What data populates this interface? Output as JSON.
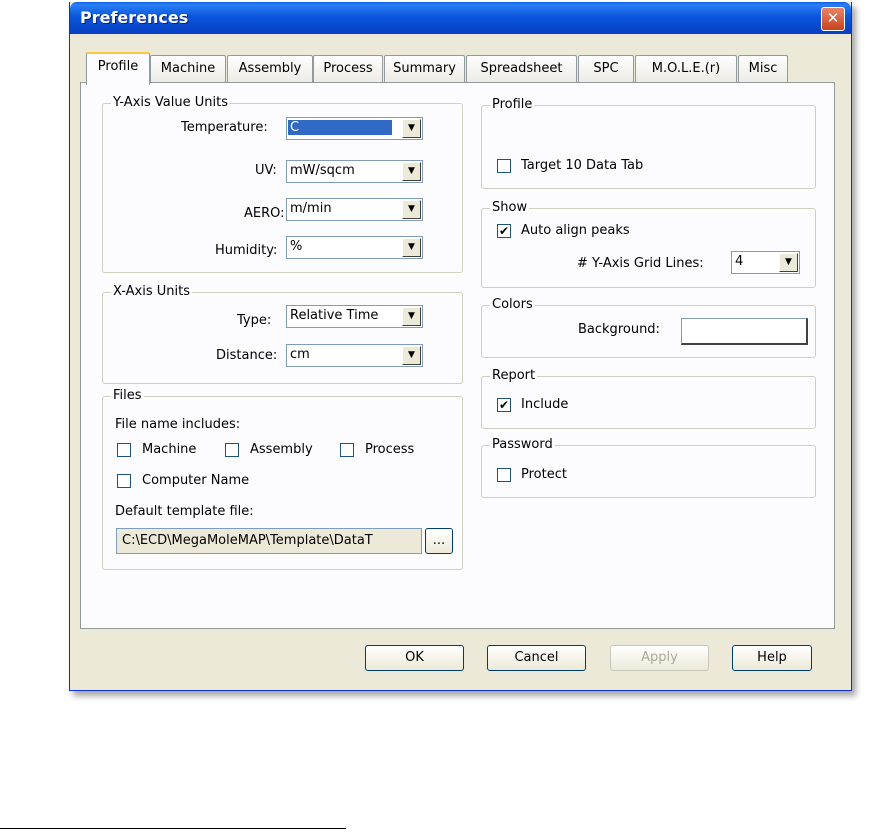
{
  "window": {
    "title": "Preferences",
    "close_glyph": "✕"
  },
  "tabs": [
    "Profile",
    "Machine",
    "Assembly",
    "Process",
    "Summary",
    "Spreadsheet",
    "SPC",
    "M.O.L.E.(r)",
    "Misc"
  ],
  "y_axis": {
    "legend": "Y-Axis Value Units",
    "temperature_label": "Temperature:",
    "temperature_value": "C",
    "uv_label": "UV:",
    "uv_value": "mW/sqcm",
    "aero_label": "AERO:",
    "aero_value": "m/min",
    "humidity_label": "Humidity:",
    "humidity_value": "%"
  },
  "x_axis": {
    "legend": "X-Axis Units",
    "type_label": "Type:",
    "type_value": "Relative Time",
    "distance_label": "Distance:",
    "distance_value": "cm"
  },
  "files": {
    "legend": "Files",
    "includes_label": "File name includes:",
    "machine": "Machine",
    "assembly": "Assembly",
    "process": "Process",
    "computer_name": "Computer Name",
    "template_label": "Default template file:",
    "template_value": "C:\\ECD\\MegaMoleMAP\\Template\\DataT",
    "browse_label": "..."
  },
  "profile": {
    "legend": "Profile",
    "target_tab": "Target 10 Data Tab",
    "target_checked": false
  },
  "show": {
    "legend": "Show",
    "auto_align": "Auto align peaks",
    "auto_align_checked": true,
    "grid_label": "# Y-Axis Grid Lines:",
    "grid_value": "4"
  },
  "colors": {
    "legend": "Colors",
    "background_label": "Background:",
    "background_color": "#ffffff"
  },
  "report": {
    "legend": "Report",
    "include": "Include",
    "include_checked": true
  },
  "password": {
    "legend": "Password",
    "protect": "Protect",
    "protect_checked": false
  },
  "buttons": {
    "ok": "OK",
    "cancel": "Cancel",
    "apply": "Apply",
    "help": "Help"
  },
  "check_glyph": "✔",
  "arrow_glyph": "▼",
  "icons": {
    "close": "close-icon",
    "dropdown": "chevron-down-icon"
  }
}
